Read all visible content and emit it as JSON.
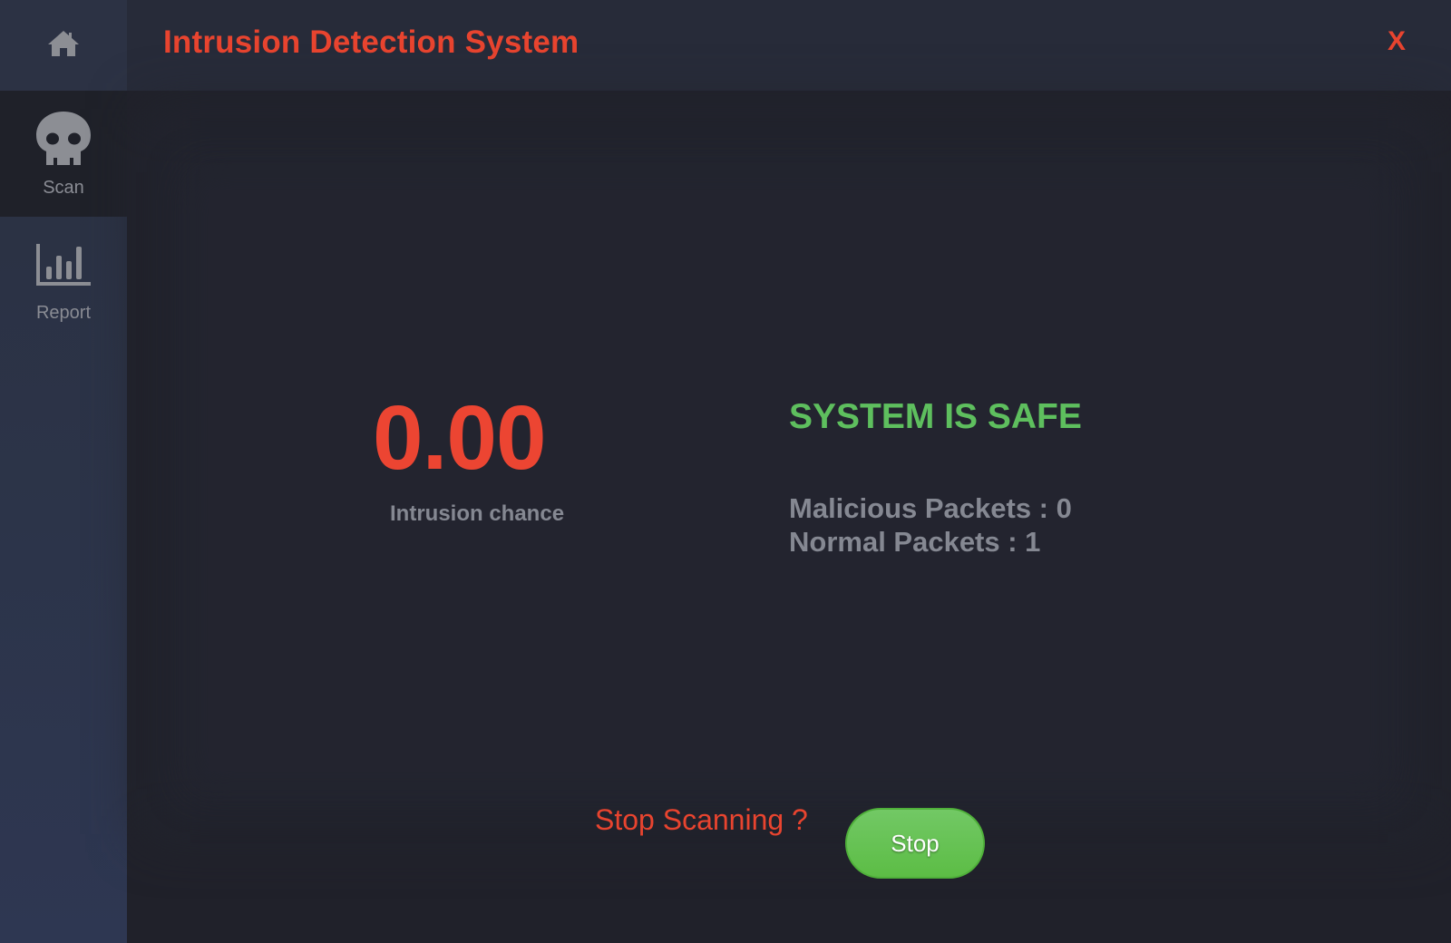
{
  "app": {
    "title": "Intrusion Detection System",
    "close_label": "X",
    "accent_color": "#e8442f"
  },
  "sidebar": {
    "home": {
      "icon": "home-icon"
    },
    "items": [
      {
        "id": "scan",
        "label": "Scan",
        "icon": "skull-icon",
        "active": true
      },
      {
        "id": "report",
        "label": "Report",
        "icon": "bar-chart-icon",
        "active": false
      }
    ]
  },
  "scan": {
    "intrusion_value": "0.00",
    "intrusion_label": "Intrusion chance",
    "status": "SYSTEM IS SAFE",
    "status_color": "#5ebf5e",
    "malicious_packets_label": "Malicious Packets : 0",
    "normal_packets_label": "Normal Packets : 1",
    "stop_prompt": "Stop Scanning ?",
    "stop_button_label": "Stop",
    "stop_button_color": "#5cbd45"
  }
}
